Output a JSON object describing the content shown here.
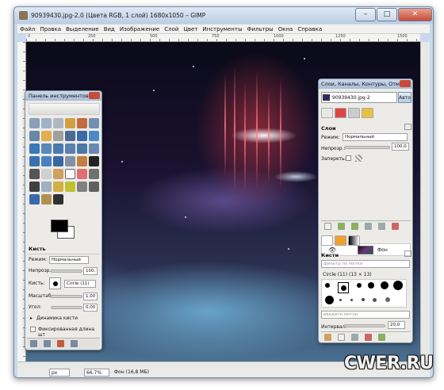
{
  "window": {
    "title": "90939430.jpg-2.0 (Цвета RGB, 1 слой) 1680x1050 – GIMP",
    "minimize": "–",
    "maximize": "□",
    "close": "✕"
  },
  "menubar": [
    "Файл",
    "Правка",
    "Выделение",
    "Вид",
    "Изображение",
    "Слой",
    "Цвет",
    "Инструменты",
    "Фильтры",
    "Окна",
    "Справка"
  ],
  "ruler": [
    "0",
    "250",
    "500",
    "750",
    "1000",
    "1250",
    "1500"
  ],
  "statusbar": {
    "unit": "px",
    "zoom": "66.7%",
    "info": "Фон (16,8 МБ)"
  },
  "toolbox": {
    "title": "Панель инструментов",
    "tool_options_title": "Кисть",
    "mode_label": "Режим:",
    "mode_value": "Нормальный",
    "opacity_label": "Непрозр.:",
    "opacity_value": "100,",
    "brush_label": "Кисть:",
    "brush_value": "Circle (11)",
    "scale_label": "Масштаб:",
    "scale_value": "1,00",
    "angle_label": "Угол:",
    "angle_value": "0,00",
    "dynamics_label": "Динамика кисти",
    "fixed_length_label": "Фиксированная длина шт"
  },
  "dock": {
    "title": "Слои, Каналы, Контуры, Отмен…",
    "image_select": "90939430.jpg-2",
    "auto_button": "Авто",
    "layers_title": "Слои",
    "mode_label": "Режим:",
    "mode_value": "Нормальный",
    "opacity_label": "Непрозр.:",
    "opacity_value": "100,0",
    "lock_label": "Запереть:",
    "layer_name": "Фон",
    "brushes_title": "Кисти",
    "filter_placeholder": "фильтр по метке",
    "brush_info": "Circle (11) (13 × 13)",
    "tag_placeholder": "введите метки",
    "interval_label": "Интервал:",
    "interval_value": "20,0"
  },
  "watermark": "CWER.RU",
  "colors": {
    "fg": "#000000",
    "bg": "#ffffff",
    "titlebar": "#bccde3",
    "close": "#c74a3a"
  }
}
